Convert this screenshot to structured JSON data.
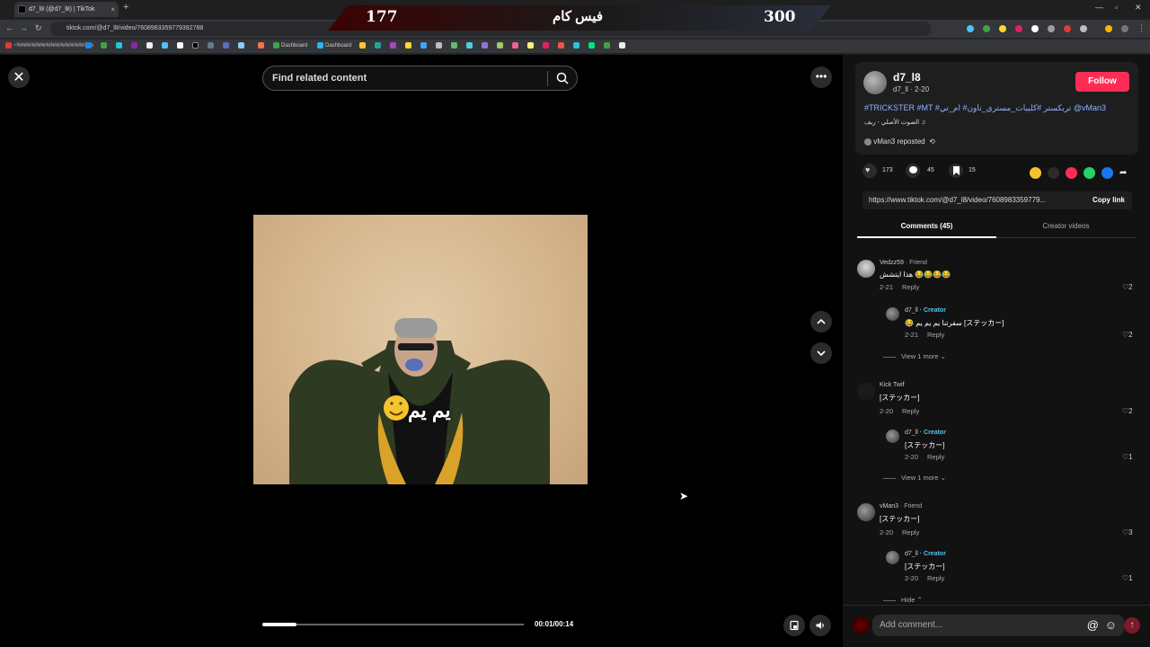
{
  "browser": {
    "tab_title": "d7_l8 (@d7_l8) | TikTok",
    "url": "tiktok.com/@d7_l8/video/7608983359779392788",
    "bookmark_short": "~%%%%%%%%%%%%%%%%",
    "bookmarks": [
      "Dashboard",
      "Dashboard"
    ]
  },
  "scoreboard": {
    "left_score": "177",
    "title": "فيس كام",
    "right_score": "300"
  },
  "viewer": {
    "search_placeholder": "Find related content",
    "timecode": "00:01/00:14",
    "progress": 0.13,
    "caption": "يم يم"
  },
  "post": {
    "username": "d7_l8",
    "subline": "d7_ll · 2-20",
    "follow_label": "Follow",
    "tags": "#TRICKSTER #MT #تريكستر #كليبات_مستري_تاون# ام_تي @vMan3",
    "music": "الصوت الأصلي - ريف ♫",
    "repost": "vMan3 reposted",
    "likes": "173",
    "comments": "45",
    "saves": "15",
    "link": "https://www.tiktok.com/@d7_l8/video/7608983359779...",
    "copy_label": "Copy link"
  },
  "tabs": {
    "comments": "Comments (45)",
    "creator": "Creator videos"
  },
  "comments": [
    {
      "name": "Vedzz59",
      "tag": "· Friend",
      "text": "هذا ايتشش 😂😂😂😂",
      "date": "2-21",
      "reply": "Reply",
      "likes": "2"
    },
    {
      "name": "d7_ll",
      "tag": "· Creator",
      "text": "😂 سفرتنا يم يم يم [ステッカー]",
      "date": "2-21",
      "reply": "Reply",
      "likes": "2"
    },
    {
      "view_more": "View 1 more"
    },
    {
      "name": "Kick Twif",
      "tag": "",
      "text": "[ステッカー]",
      "date": "2-20",
      "reply": "Reply",
      "likes": "2"
    },
    {
      "name": "d7_ll",
      "tag": "· Creator",
      "text": "[ステッカー]",
      "date": "2-20",
      "reply": "Reply",
      "likes": "1"
    },
    {
      "view_more": "View 1 more"
    },
    {
      "name": "vMan3",
      "tag": "· Friend",
      "text": "[ステッカー]",
      "date": "2-20",
      "reply": "Reply",
      "likes": "3"
    },
    {
      "name": "d7_ll",
      "tag": "· Creator",
      "text": "[ステッカー]",
      "date": "2-20",
      "reply": "Reply",
      "likes": "1"
    },
    {
      "hide": "Hide"
    }
  ],
  "composer": {
    "placeholder": "Add comment..."
  },
  "colors": {
    "accent": "#fe2c55",
    "creator_tag": "#4fc3f7"
  }
}
